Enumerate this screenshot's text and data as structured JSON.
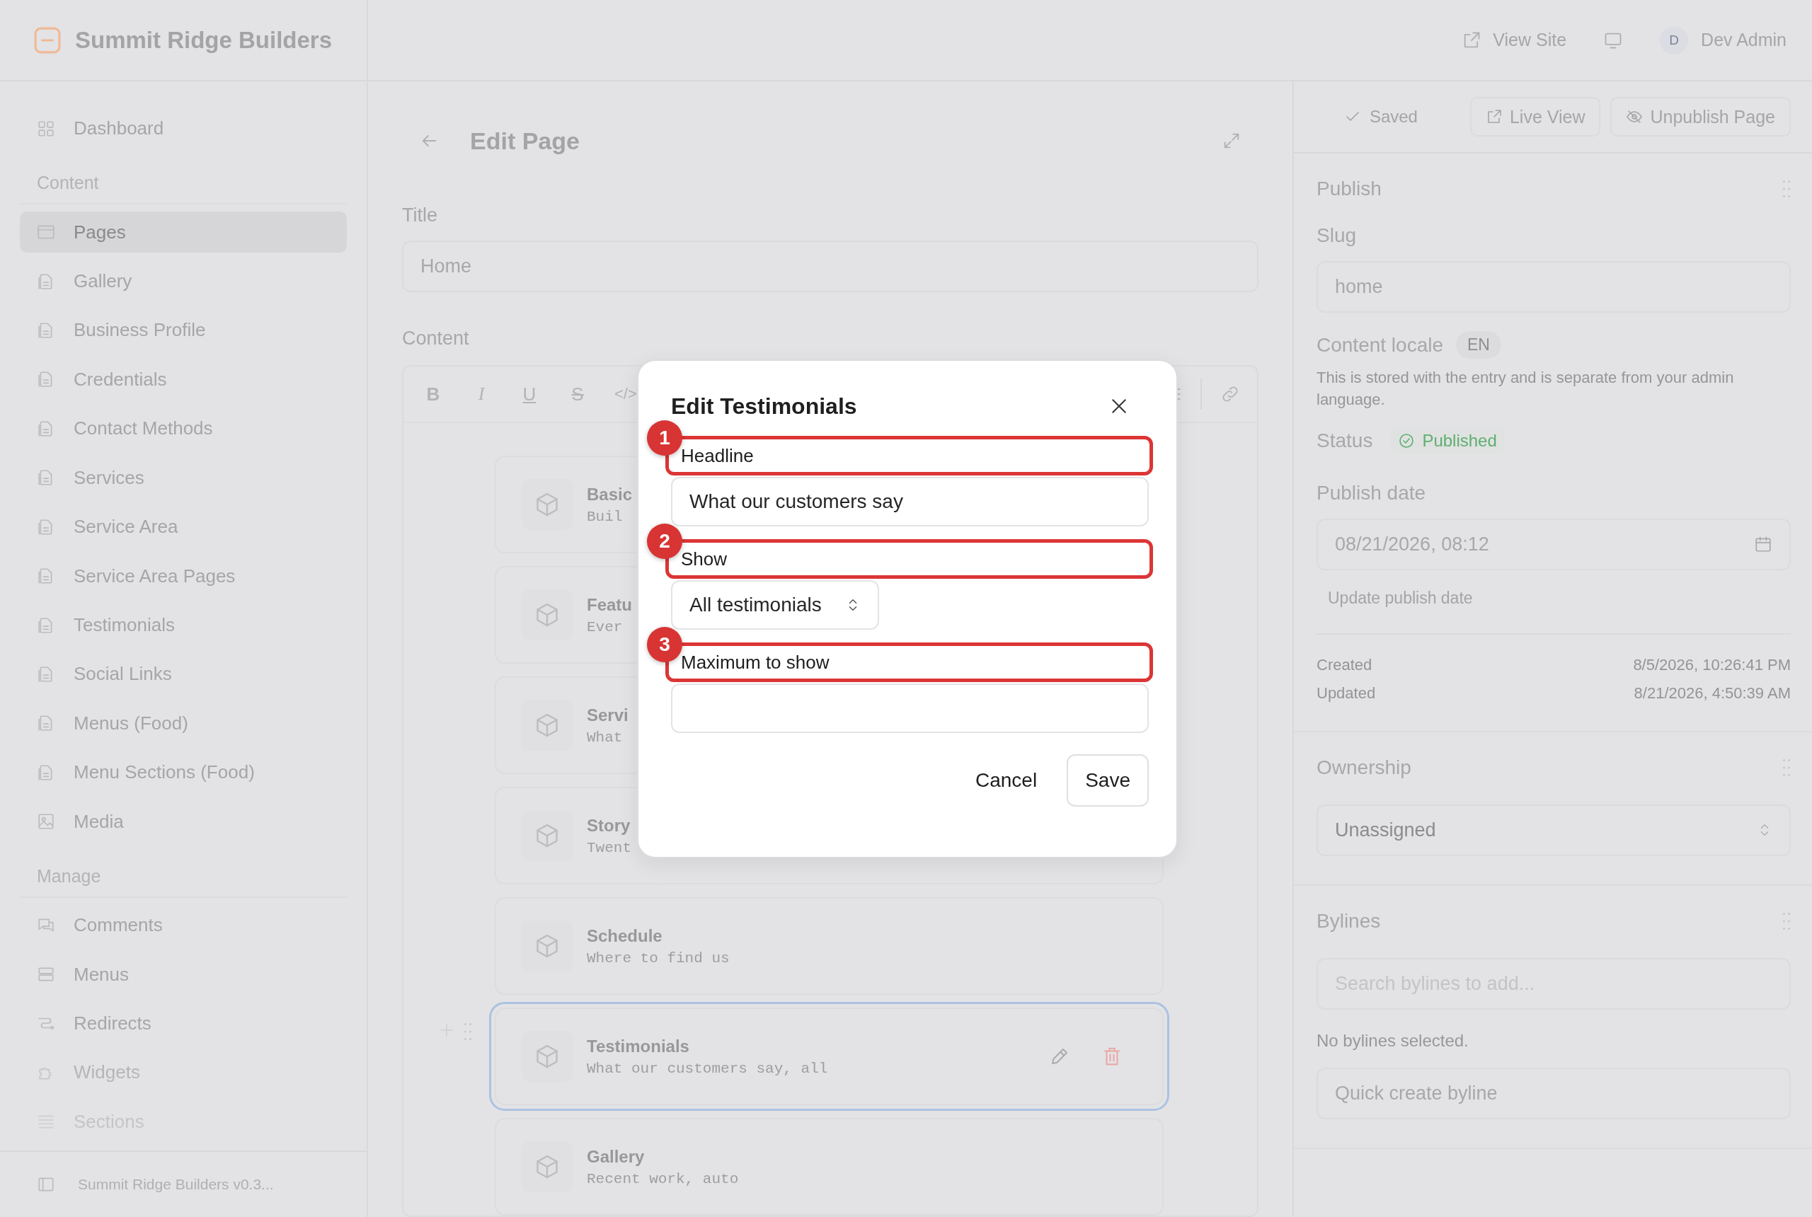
{
  "brand": {
    "name": "Summit Ridge Builders"
  },
  "topbar": {
    "view_site": "View Site",
    "user": {
      "initial": "D",
      "name": "Dev Admin"
    }
  },
  "sidebar": {
    "sections": [
      {
        "items": [
          {
            "label": "Dashboard",
            "kind": "dashboard",
            "selected": false
          }
        ]
      },
      {
        "heading": "Content",
        "items": [
          {
            "label": "Pages",
            "kind": "pages",
            "selected": true
          },
          {
            "label": "Gallery",
            "kind": "doc",
            "selected": false
          },
          {
            "label": "Business Profile",
            "kind": "doc",
            "selected": false
          },
          {
            "label": "Credentials",
            "kind": "doc",
            "selected": false
          },
          {
            "label": "Contact Methods",
            "kind": "doc",
            "selected": false
          },
          {
            "label": "Services",
            "kind": "doc",
            "selected": false
          },
          {
            "label": "Service Area",
            "kind": "doc",
            "selected": false
          },
          {
            "label": "Service Area Pages",
            "kind": "doc",
            "selected": false
          },
          {
            "label": "Testimonials",
            "kind": "doc",
            "selected": false
          },
          {
            "label": "Social Links",
            "kind": "doc",
            "selected": false
          },
          {
            "label": "Menus (Food)",
            "kind": "doc",
            "selected": false
          },
          {
            "label": "Menu Sections (Food)",
            "kind": "doc",
            "selected": false
          },
          {
            "label": "Media",
            "kind": "media",
            "selected": false
          }
        ]
      },
      {
        "heading": "Manage",
        "items": [
          {
            "label": "Comments",
            "kind": "comments",
            "selected": false
          },
          {
            "label": "Menus",
            "kind": "menus",
            "selected": false
          },
          {
            "label": "Redirects",
            "kind": "redirects",
            "selected": false
          },
          {
            "label": "Widgets",
            "kind": "widgets",
            "selected": false
          },
          {
            "label": "Sections",
            "kind": "sections",
            "selected": false
          }
        ]
      }
    ],
    "footer": "Summit Ridge Builders v0.3..."
  },
  "editor": {
    "title": "Edit Page",
    "title_label": "Title",
    "title_value": "Home",
    "content_label": "Content",
    "toolbar": [
      {
        "kind": "bold",
        "label": "B"
      },
      {
        "kind": "italic",
        "label": "I"
      },
      {
        "kind": "underline",
        "label": "U"
      },
      {
        "kind": "strike",
        "label": "S"
      },
      {
        "kind": "code",
        "label": "</>"
      }
    ],
    "blocks": [
      {
        "title": "Basic",
        "subtitle": "Buil",
        "selected": false
      },
      {
        "title": "Featu",
        "subtitle": "Ever",
        "selected": false
      },
      {
        "title": "Servi",
        "subtitle": "What",
        "selected": false
      },
      {
        "title": "Story",
        "subtitle": "Twent",
        "selected": false
      },
      {
        "title": "Schedule",
        "subtitle": "Where to find us",
        "selected": false
      },
      {
        "title": "Testimonials",
        "subtitle": "What our customers say, all",
        "selected": true
      },
      {
        "title": "Gallery",
        "subtitle": "Recent work, auto",
        "selected": false
      }
    ]
  },
  "panel": {
    "actions": {
      "saved": {
        "label": "Saved",
        "disabled": true
      },
      "live_view": "Live View",
      "unpublish": "Unpublish Page"
    },
    "publish": {
      "title": "Publish",
      "slug_label": "Slug",
      "slug_value": "home",
      "locale_label": "Content locale",
      "locale": "EN",
      "locale_help": "This is stored with the entry and is separate from your admin language.",
      "status_label": "Status",
      "status": "Published",
      "date_label": "Publish date",
      "date_value": "08/21/2026, 08:12",
      "update_link": {
        "label": "Update publish date",
        "disabled": true
      },
      "meta": [
        {
          "label": "Created",
          "value": "8/5/2026, 10:26:41 PM"
        },
        {
          "label": "Updated",
          "value": "8/21/2026, 4:50:39 AM"
        }
      ]
    },
    "ownership": {
      "title": "Ownership",
      "value": "Unassigned"
    },
    "bylines": {
      "title": "Bylines",
      "placeholder": "Search bylines to add...",
      "empty": "No bylines selected.",
      "button": "Quick create byline"
    }
  },
  "modal": {
    "title": "Edit Testimonials",
    "fields": [
      {
        "marker": "1",
        "label": "Headline",
        "kind": "text",
        "value": "What our customers say"
      },
      {
        "marker": "2",
        "label": "Show",
        "kind": "select",
        "value": "All testimonials"
      },
      {
        "marker": "3",
        "label": "Maximum to show",
        "kind": "number"
      }
    ],
    "buttons": [
      {
        "label": "Cancel",
        "kind": "text"
      },
      {
        "label": "Save",
        "kind": "outline"
      }
    ]
  }
}
